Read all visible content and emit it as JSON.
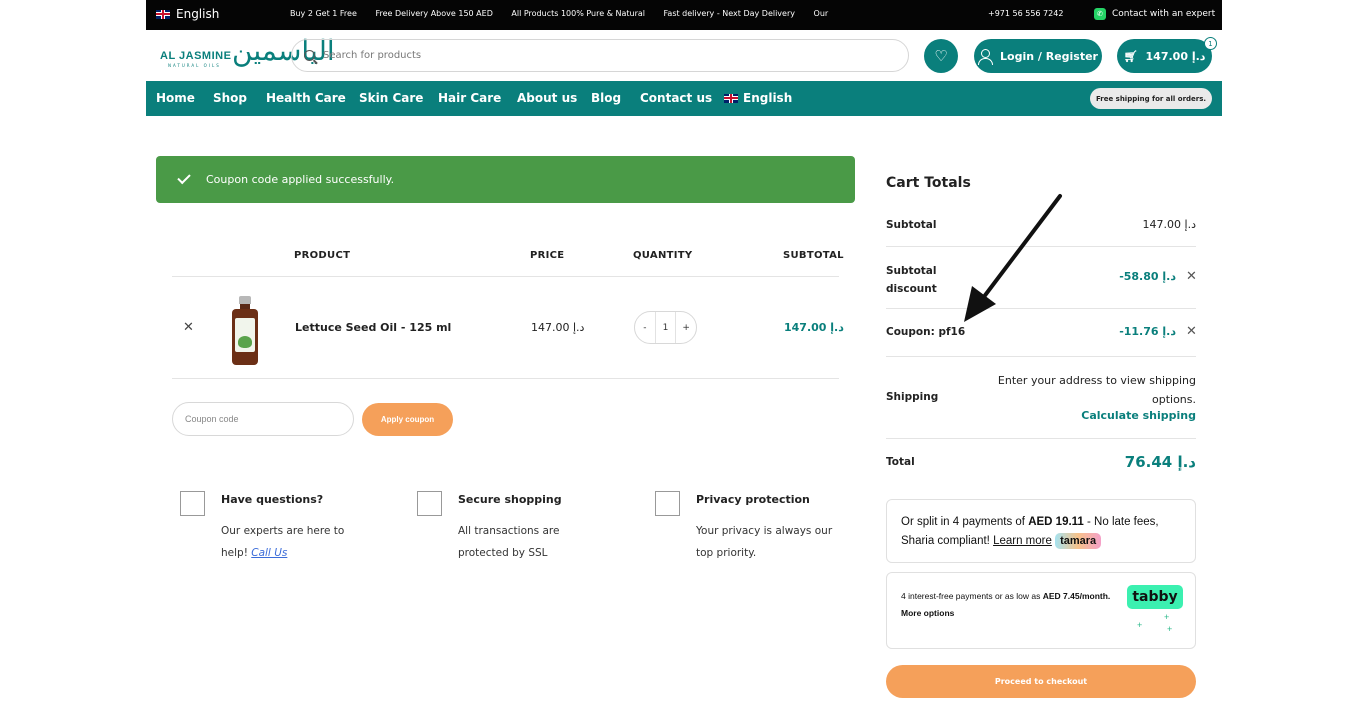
{
  "topbar": {
    "language": "English",
    "ticker": [
      "Buy 2 Get 1 Free",
      "Free Delivery Above 150 AED",
      "All Products 100% Pure & Natural",
      "Fast delivery - Next Day Delivery",
      "Our pro"
    ],
    "phone": "+971 56 556 7242",
    "contact": "Contact with an expert"
  },
  "header": {
    "logo_text": "AL JASMINE",
    "logo_sub": "NATURAL OILS",
    "logo_arabic": "الياسمين",
    "search_placeholder": "Search for products",
    "login_label": "Login / Register",
    "cart_total": "147.00 د.إ",
    "cart_count": "1"
  },
  "nav": {
    "items": [
      "Home",
      "Shop",
      "Health Care",
      "Skin Care",
      "Hair Care",
      "About us",
      "Blog",
      "Contact us",
      "English"
    ],
    "shipping_pill": "Free shipping for all orders."
  },
  "alert": {
    "message": "Coupon code applied successfully."
  },
  "cart_table": {
    "headers": {
      "product": "PRODUCT",
      "price": "PRICE",
      "quantity": "QUANTITY",
      "subtotal": "SUBTOTAL"
    },
    "rows": [
      {
        "name": "Lettuce Seed Oil - 125 ml",
        "price": "147.00 د.إ",
        "qty": "1",
        "subtotal": "147.00 د.إ"
      }
    ],
    "coupon_placeholder": "Coupon code",
    "apply_label": "Apply coupon"
  },
  "features": [
    {
      "title": "Have questions?",
      "desc": "Our experts are here to help!",
      "link": "Call Us"
    },
    {
      "title": "Secure shopping",
      "desc": "All transactions are protected by SSL"
    },
    {
      "title": "Privacy protection",
      "desc": "Your privacy is always our top priority."
    }
  ],
  "totals": {
    "title": "Cart Totals",
    "subtotal_label": "Subtotal",
    "subtotal_value": "147.00 د.إ",
    "discount_label": "Subtotal discount",
    "discount_value": "-58.80 د.إ",
    "coupon_label": "Coupon: pf16",
    "coupon_value": "-11.76 د.إ",
    "shipping_label": "Shipping",
    "shipping_note": "Enter your address to view shipping options.",
    "shipping_link": "Calculate shipping",
    "total_label": "Total",
    "total_value": "76.44 د.إ"
  },
  "tamara": {
    "pre": "Or split in 4 payments of ",
    "amount": "AED 19.11",
    "post": " - No late fees, Sharia compliant!",
    "link": "Learn more",
    "logo": "tamara"
  },
  "tabby": {
    "pre": "4 interest-free payments or as low as ",
    "amount": "AED 7.45/month.",
    "link": "More options",
    "logo": "tabby"
  },
  "checkout_label": "Proceed to checkout",
  "colors": {
    "brand": "#0a7f7c",
    "accent": "#f5a05a",
    "success": "#4a9a47"
  }
}
